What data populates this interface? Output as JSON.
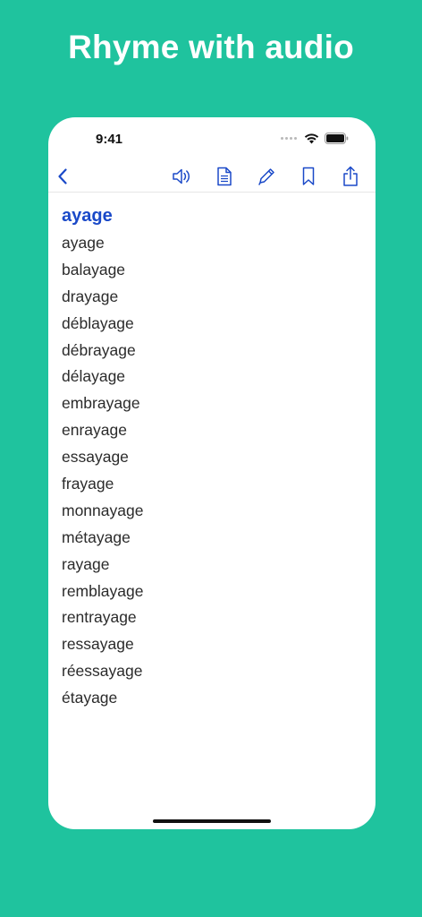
{
  "promo": {
    "title": "Rhyme with audio"
  },
  "status_bar": {
    "time": "9:41"
  },
  "toolbar": {
    "back_icon": "chevron-left-icon",
    "icons": [
      "speaker-icon",
      "document-icon",
      "pencil-icon",
      "bookmark-icon",
      "share-icon"
    ],
    "accent_color": "#1a49c8"
  },
  "main": {
    "heading": "ayage",
    "rhymes": [
      "ayage",
      "balayage",
      "drayage",
      "déblayage",
      "débrayage",
      "délayage",
      "embrayage",
      "enrayage",
      "essayage",
      "frayage",
      "monnayage",
      "métayage",
      "rayage",
      "remblayage",
      "rentrayage",
      "ressayage",
      "réessayage",
      "étayage"
    ]
  },
  "colors": {
    "background": "#1fc39e",
    "card": "#ffffff",
    "heading": "#1a49c8",
    "text": "#2b2b2b"
  }
}
